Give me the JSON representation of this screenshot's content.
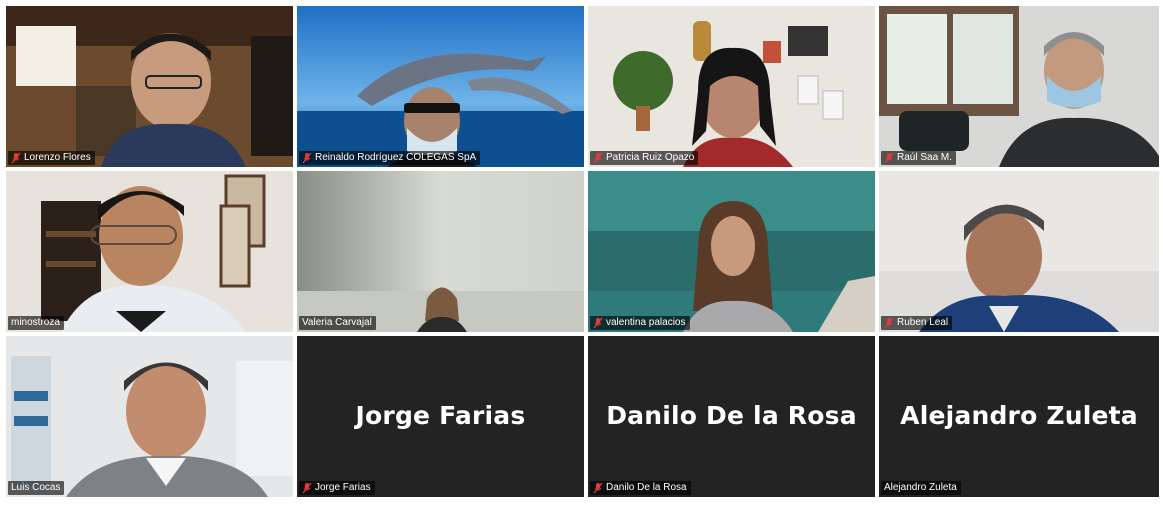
{
  "meeting": {
    "participants": [
      {
        "name": "Lorenzo Flores",
        "muted": true
      },
      {
        "name": "Reinaldo Rodríguez  COLEGAS SpA",
        "muted": true
      },
      {
        "name": "Patricia Ruiz Opazo",
        "muted": true
      },
      {
        "name": "Raúl Saa M.",
        "muted": true
      },
      {
        "name": "minostroza",
        "muted": false
      },
      {
        "name": "Valeria Carvajal",
        "muted": false
      },
      {
        "name": "valentina palacios",
        "muted": true
      },
      {
        "name": "Ruben Leal",
        "muted": true
      },
      {
        "name": "Luis Cocas",
        "muted": false,
        "active_speaker": true
      },
      {
        "name": "Jorge Farias",
        "muted": true,
        "video_off": true,
        "display_name": "Jorge Farias"
      },
      {
        "name": "Danilo De la Rosa",
        "muted": true,
        "video_off": true,
        "display_name": "Danilo De la Rosa"
      },
      {
        "name": "Alejandro Zuleta",
        "muted": false,
        "video_off": true,
        "display_name": "Alejandro Zuleta"
      }
    ]
  },
  "colors": {
    "muted_mic": "#e23b3b",
    "active_speaker_border": "#c9e06a",
    "video_off_bg": "#232323"
  },
  "icons": {
    "muted": "mic-muted-icon"
  }
}
